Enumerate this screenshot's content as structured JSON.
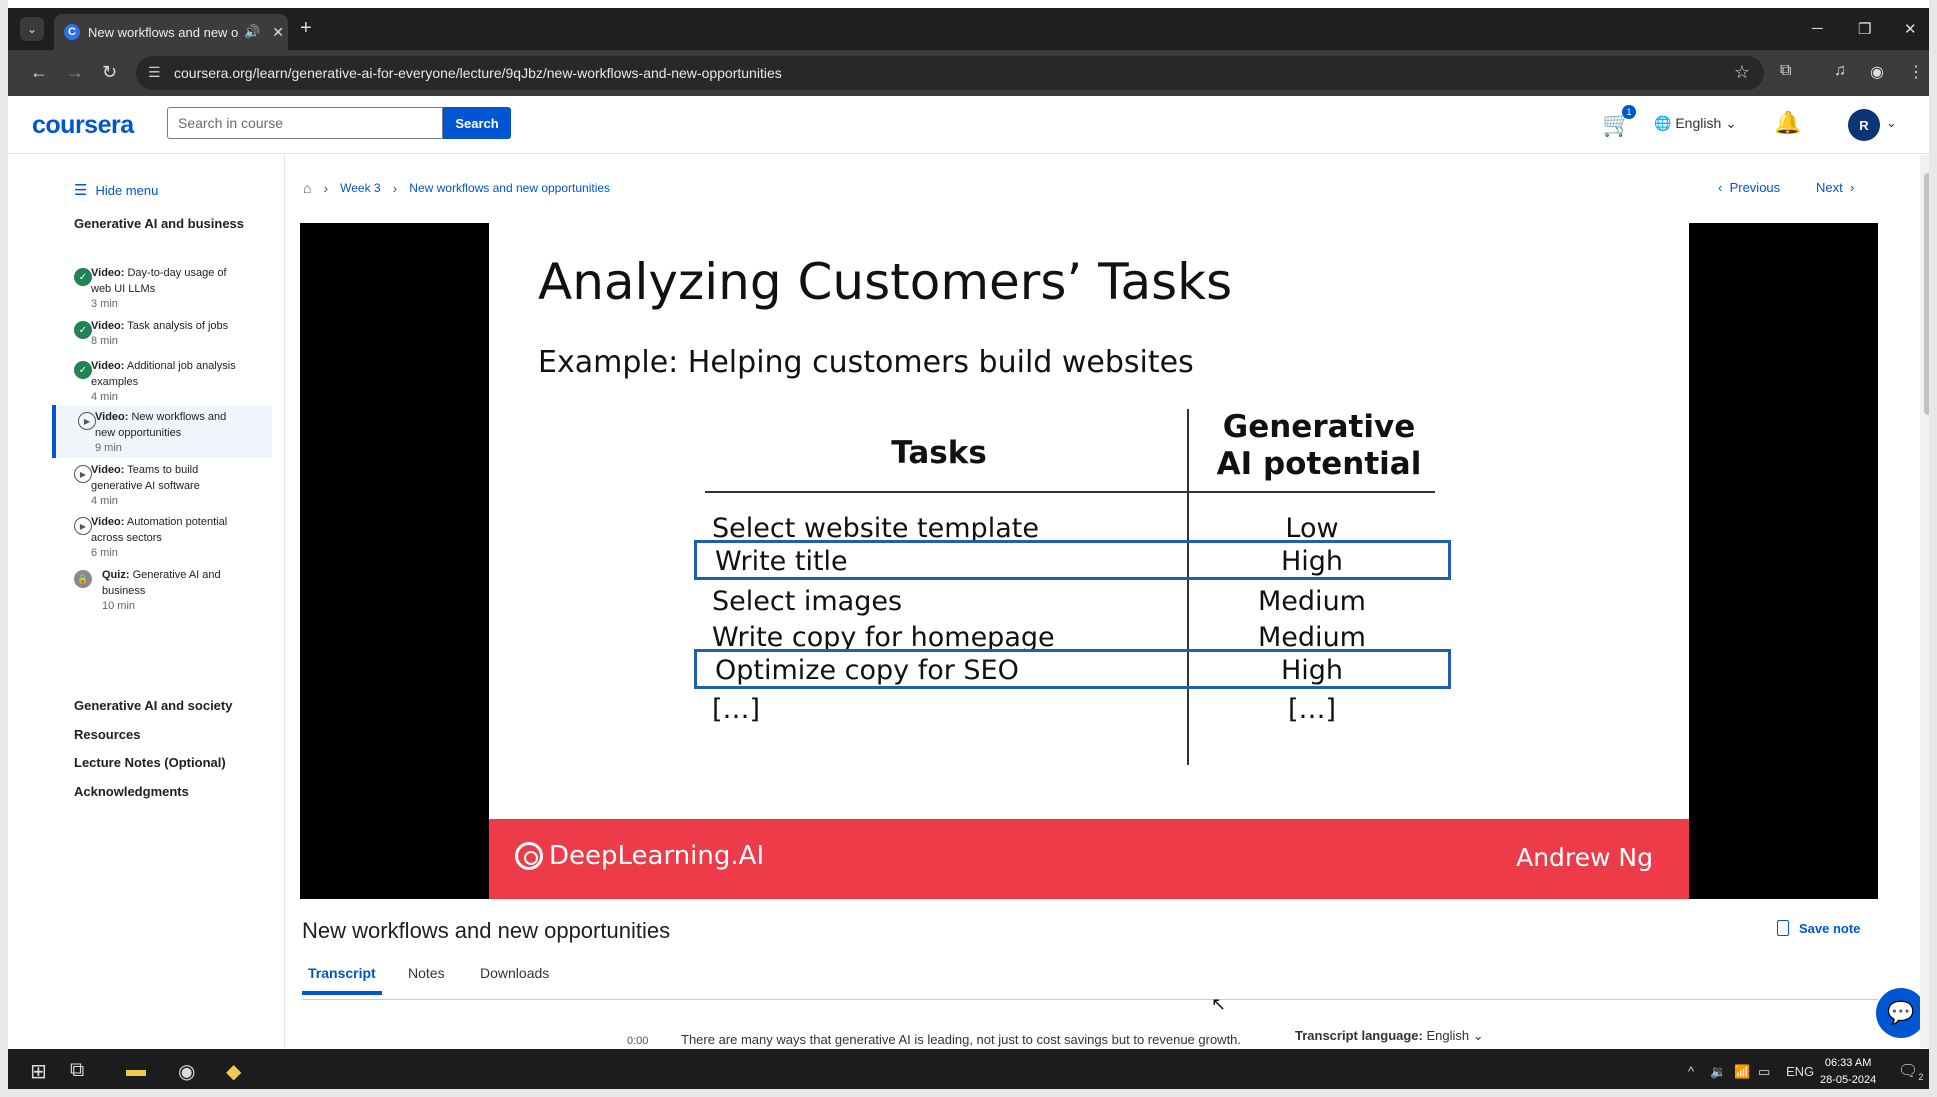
{
  "browser": {
    "tab_title": "New workflows and new op",
    "url": "coursera.org/learn/generative-ai-for-everyone/lecture/9qJbz/new-workflows-and-new-opportunities"
  },
  "header": {
    "logo": "coursera",
    "search_placeholder": "Search in course",
    "search_button": "Search",
    "cart_count": "1",
    "language": "English",
    "avatar_initial": "R"
  },
  "sidebar": {
    "hide_menu": "Hide menu",
    "module_title": "Generative AI and business",
    "items": [
      {
        "kind": "Video:",
        "title": "Day-to-day usage of web UI LLMs",
        "duration": "3 min",
        "status": "done"
      },
      {
        "kind": "Video:",
        "title": "Task analysis of jobs",
        "duration": "8 min",
        "status": "done"
      },
      {
        "kind": "Video:",
        "title": "Additional job analysis examples",
        "duration": "4 min",
        "status": "done"
      },
      {
        "kind": "Video:",
        "title": "New workflows and new opportunities",
        "duration": "9 min",
        "status": "current"
      },
      {
        "kind": "Video:",
        "title": "Teams to build generative AI software",
        "duration": "4 min",
        "status": "todo"
      },
      {
        "kind": "Video:",
        "title": "Automation potential across sectors",
        "duration": "6 min",
        "status": "todo"
      },
      {
        "kind": "Quiz:",
        "title": "Generative AI and business",
        "duration": "10 min",
        "status": "locked"
      }
    ],
    "sections": [
      "Generative AI and society",
      "Resources",
      "Lecture Notes (Optional)",
      "Acknowledgments"
    ]
  },
  "breadcrumb": {
    "week": "Week 3",
    "page": "New workflows and new opportunities"
  },
  "nav": {
    "previous": "Previous",
    "next": "Next"
  },
  "slide": {
    "title": "Analyzing Customers’ Tasks",
    "subtitle": "Example: Helping customers build websites",
    "col_tasks": "Tasks",
    "col_potential": "Generative AI potential",
    "rows": [
      {
        "task": "Select website template",
        "potential": "Low",
        "highlighted": false
      },
      {
        "task": "Write title",
        "potential": "High",
        "highlighted": true
      },
      {
        "task": "Select images",
        "potential": "Medium",
        "highlighted": false
      },
      {
        "task": "Write copy for homepage",
        "potential": "Medium",
        "highlighted": false
      },
      {
        "task": "Optimize copy for SEO",
        "potential": "High",
        "highlighted": true
      },
      {
        "task": "[…]",
        "potential": "[…]",
        "highlighted": false
      }
    ],
    "brand": "DeepLearning.AI",
    "author": "Andrew Ng",
    "brand_color": "#ed3b4a",
    "highlight_color": "#1d5fb0"
  },
  "lecture": {
    "title": "New workflows and new opportunities",
    "save_note": "Save note",
    "tabs": [
      "Transcript",
      "Notes",
      "Downloads"
    ],
    "active_tab": "Transcript",
    "transcript_time": "0:00",
    "transcript_text": "There are many ways that generative AI is leading, not just to cost savings but to revenue growth.",
    "transcript_language_label": "Transcript language:",
    "transcript_language": "English"
  },
  "taskbar": {
    "lang": "ENG",
    "time": "06:33 AM",
    "date": "28-05-2024",
    "notifications": "2"
  }
}
